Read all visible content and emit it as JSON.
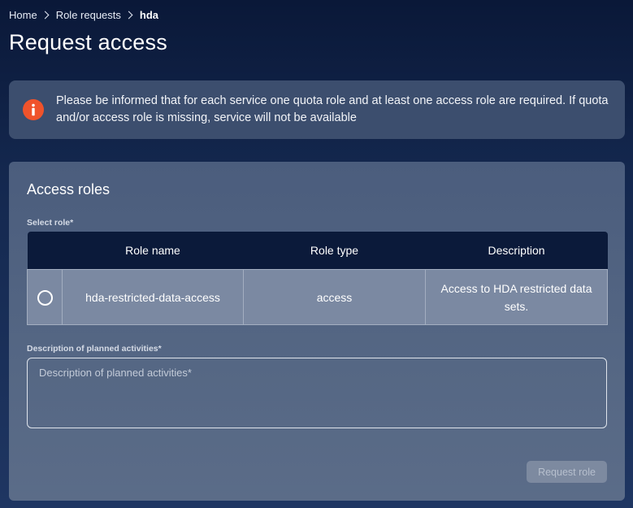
{
  "breadcrumb": {
    "items": [
      "Home",
      "Role requests"
    ],
    "current": "hda"
  },
  "page": {
    "title": "Request access"
  },
  "alert": {
    "icon": "info-icon",
    "icon_color": "#f0532b",
    "message": "Please be informed that for each service one quota role and at least one access role are required. If quota and/or access role is missing, service will not be available"
  },
  "access_roles": {
    "title": "Access roles",
    "select_label": "Select role*",
    "table": {
      "columns": [
        "",
        "Role name",
        "Role type",
        "Description"
      ],
      "rows": [
        {
          "selected": false,
          "role_name": "hda-restricted-data-access",
          "role_type": "access",
          "description": "Access to HDA restricted data sets."
        }
      ]
    },
    "description_label": "Description of planned activities*",
    "description_placeholder": "Description of planned activities*",
    "description_value": "",
    "submit_label": "Request role",
    "submit_enabled": false
  }
}
